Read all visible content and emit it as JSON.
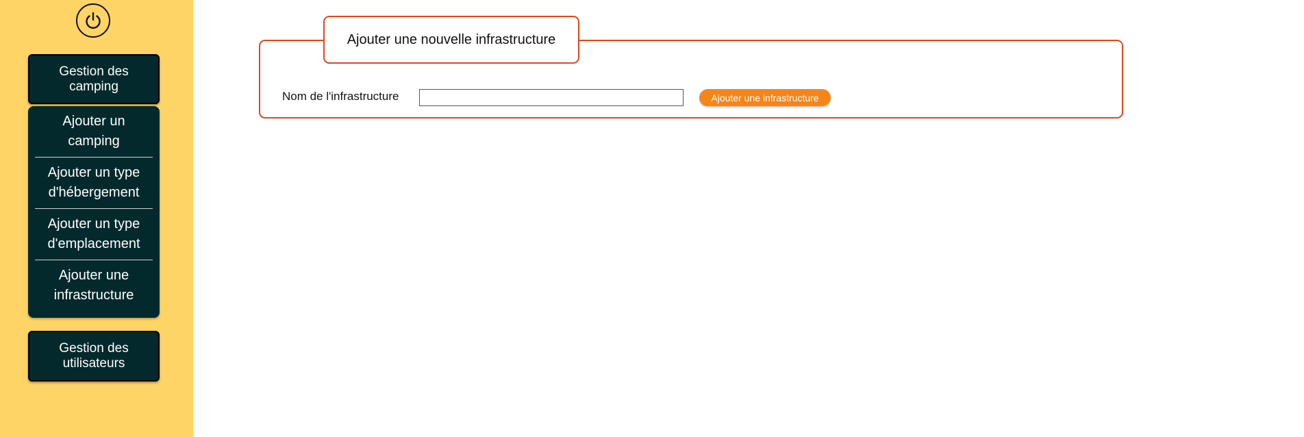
{
  "sidebar": {
    "power_icon": "power-icon",
    "camping_management": "Gestion des camping",
    "submenu": [
      {
        "label": "Ajouter un camping"
      },
      {
        "label": "Ajouter un type d'hébergement"
      },
      {
        "label": "Ajouter un type d'emplacement"
      },
      {
        "label": "Ajouter une infrastructure"
      }
    ],
    "user_management": "Gestion des utilisateurs"
  },
  "form": {
    "title": "Ajouter une nouvelle infrastructure",
    "name_label": "Nom de l'infrastructure",
    "name_value": "",
    "name_placeholder": "",
    "submit_label": "Ajouter une infrastructure"
  },
  "colors": {
    "sidebar_bg": "#ffd466",
    "nav_bg": "#04292c",
    "accent": "#e2461a",
    "button": "#f58519"
  }
}
